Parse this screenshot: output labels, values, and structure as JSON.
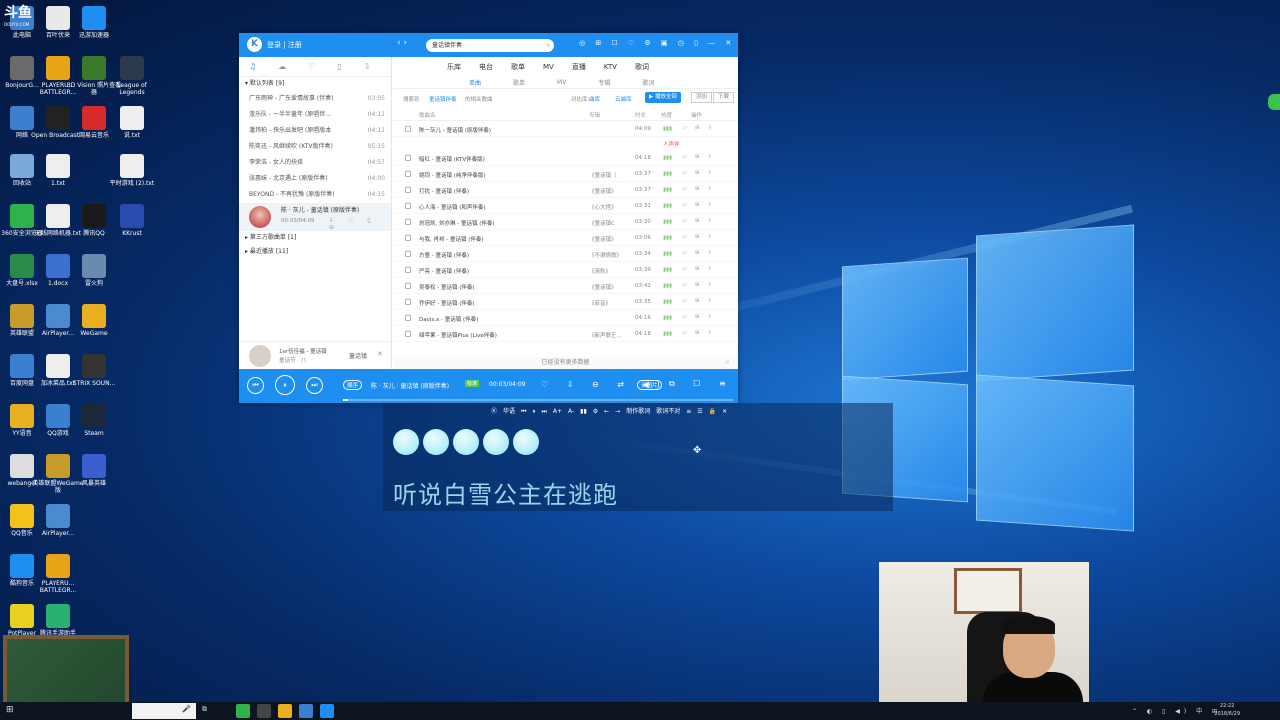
{
  "watermark": {
    "brand": "斗鱼",
    "sub": "DOUYU.COM"
  },
  "desktop_icons": [
    {
      "label": "此电脑",
      "icon": "computer-icon",
      "color": "#3b7fd0"
    },
    {
      "label": "百叶伏来",
      "icon": "file-icon",
      "color": "#e9e9e9"
    },
    {
      "label": "迅游加速器",
      "icon": "kugou-icon",
      "color": "#1f8ef1"
    },
    {
      "label": "BonjourG...",
      "icon": "game-icon",
      "color": "#6a6a6a"
    },
    {
      "label": "PLAYERU... BATTLEGR...",
      "icon": "pubg-icon",
      "color": "#e8a317"
    },
    {
      "label": "3D Vision 照片查看器",
      "icon": "nvidia-icon",
      "color": "#3a7a2a"
    },
    {
      "label": "League of Legends",
      "icon": "lol-icon",
      "color": "#2a3a4a"
    },
    {
      "label": "网络",
      "icon": "network-icon",
      "color": "#3b7fd0"
    },
    {
      "label": "Open Broadcast...",
      "icon": "obs-icon",
      "color": "#222"
    },
    {
      "label": "网易云音乐",
      "icon": "netease-icon",
      "color": "#d62b2b"
    },
    {
      "label": "说.txt",
      "icon": "txt-icon",
      "color": "#eee"
    },
    {
      "label": "回收站",
      "icon": "recycle-bin-icon",
      "color": "#7aa8d8"
    },
    {
      "label": "1.txt",
      "icon": "txt-icon",
      "color": "#eee"
    },
    {
      "label": "平时游戏 (2).txt",
      "icon": "txt-icon",
      "color": "#eee"
    },
    {
      "label": "360安全浏览器",
      "icon": "browser-icon",
      "color": "#2db34a"
    },
    {
      "label": "无线网络机器.txt",
      "icon": "txt-icon",
      "color": "#eee"
    },
    {
      "label": "腾讯QQ",
      "icon": "qq-icon",
      "color": "#1a1a1a"
    },
    {
      "label": "KKrust",
      "icon": "tool-icon",
      "color": "#2b4ab0"
    },
    {
      "label": "大盘号.xlsx",
      "icon": "xlsx-icon",
      "color": "#2a8a4a"
    },
    {
      "label": "1.docx",
      "icon": "docx-icon",
      "color": "#3b6fd0"
    },
    {
      "label": "雷火狗",
      "icon": "game-icon",
      "color": "#6a8ab0"
    },
    {
      "label": "英雄联盟",
      "icon": "game-icon",
      "color": "#c79a2a"
    },
    {
      "label": "AirPlayer...",
      "icon": "airplayer-icon",
      "color": "#4a8ad0"
    },
    {
      "label": "WeGame",
      "icon": "wegame-icon",
      "color": "#e8b020"
    },
    {
      "label": "百度网盘",
      "icon": "baidu-cloud-icon",
      "color": "#3b7fd0"
    },
    {
      "label": "加冰菜品.txt",
      "icon": "txt-icon",
      "color": "#eee"
    },
    {
      "label": "STRIX SOUN...",
      "icon": "strix-icon",
      "color": "#333"
    },
    {
      "label": "YY语音",
      "icon": "yy-icon",
      "color": "#e8b020"
    },
    {
      "label": "QQ游戏",
      "icon": "qq-game-icon",
      "color": "#3b7fd0"
    },
    {
      "label": "Steam",
      "icon": "steam-icon",
      "color": "#1b2838"
    },
    {
      "label": "webangel",
      "icon": "web-icon",
      "color": "#ddd"
    },
    {
      "label": "英雄联盟WeGame版",
      "icon": "game-icon",
      "color": "#c79a2a"
    },
    {
      "label": "风暴英雄",
      "icon": "game-icon",
      "color": "#3b5fd0"
    },
    {
      "label": "QQ音乐",
      "icon": "qq-music-icon",
      "color": "#f2c21a"
    },
    {
      "label": "AirPlayer...",
      "icon": "airplayer-icon",
      "color": "#4a8ad0"
    },
    {
      "label": "酷狗音乐",
      "icon": "kugou-icon",
      "color": "#1f8ef1"
    },
    {
      "label": "PLAYERU... BATTLEGR...",
      "icon": "pubg-icon",
      "color": "#e8a317"
    },
    {
      "label": "PotPlayer",
      "icon": "potplayer-icon",
      "color": "#e8d020"
    },
    {
      "label": "腾讯手游助手",
      "icon": "tencent-icon",
      "color": "#2ab070"
    }
  ],
  "player": {
    "login": "登录 | 注册",
    "search": "童话镇伴奏",
    "window_tools": "◎ ⊞ ☐ ♡ ⚙ ▣ ◷ ▯ — ✕",
    "left_nav_icons": [
      "♫",
      "☁",
      "♡",
      "▯",
      "⇩"
    ],
    "top_nav": [
      "乐库",
      "电台",
      "歌单",
      "MV",
      "直播",
      "KTV",
      "歌词"
    ],
    "sub_nav": [
      "单曲",
      "歌单",
      "MV",
      "专辑",
      "歌词"
    ],
    "default_list": "▾ 默认列表 [9]",
    "left_songs": [
      {
        "title": "广东雨神 - 广东爱情故事 (伴奏)",
        "time": "03:05"
      },
      {
        "title": "渣乐队 - 一半半童年 (原唱伴...",
        "time": "04:11"
      },
      {
        "title": "潘玮柏 - 快乐出发吧 (原唱版本",
        "time": "04:11"
      },
      {
        "title": "陈奕迅 - 风继续吹 (KTV版伴奏)",
        "time": "05:15"
      },
      {
        "title": "李荣浩 - 女人的抉择",
        "time": "04:57"
      },
      {
        "title": "张惠妹 - 北京遇上 (原版伴奏)",
        "time": "04:00"
      },
      {
        "title": "BEYOND - 不再犹豫 (原版伴奏)",
        "time": "04:15"
      }
    ],
    "now_playing": {
      "title": "陈 · 灰儿 - 童话镇 (原版伴奏)",
      "time": "00:03/04:09",
      "icons": "⇩ ♡ ▯ ⊖"
    },
    "group_third": "▸ 第三方歌曲单 [1]",
    "group_recent": "▸ 最近播放 [11]",
    "search_bar": {
      "label": "搜索到",
      "keyword": "童话镇伴奏",
      "related": "的相关歌曲",
      "filter": "对比库:",
      "opt1": "曲库",
      "opt2": "云端库",
      "play_all": "▶ 播放全部",
      "add": "添加",
      "download": "下载"
    },
    "table_head": {
      "name": "歌曲名",
      "album": "专辑",
      "duration": "时长",
      "hot": "热度",
      "ops": "操作"
    },
    "results": [
      {
        "name": "陈一灰儿 - 童话镇 (原版伴奏)",
        "album": "",
        "duration": "04:09"
      },
      {
        "name": "暗杠 - 童话镇 (KTV伴奏版)",
        "album": "",
        "duration": "04:18"
      },
      {
        "name": "姚钧 - 童话镇 (纯净伴奏版)",
        "album": "《童话镇（",
        "duration": "03:37"
      },
      {
        "name": "打扰 - 童话镇 (伴奏)",
        "album": "《童话镇》",
        "duration": "03:37"
      },
      {
        "name": "心人海 - 童话镇 (和声伴奏)",
        "album": "《心大怪》",
        "duration": "03:31"
      },
      {
        "name": "刘冠凯, 刘亦琳 - 童话镇 (伴奏)",
        "album": "《童话镇C",
        "duration": "03:30"
      },
      {
        "name": "与我, 肖邦 - 童话镇 (伴奏)",
        "album": "《童话镇》",
        "duration": "03:06"
      },
      {
        "name": "方童 - 童话镇 (伴奏)",
        "album": "《不谢情歌》",
        "duration": "03:34"
      },
      {
        "name": "严亮 - 童话镇 (伴奏)",
        "album": "《清秋》",
        "duration": "03:39"
      },
      {
        "name": "吴泰权 - 童话镇 (伴奏)",
        "album": "《童话镇》",
        "duration": "03:42"
      },
      {
        "name": "乔伊好 - 童话镇 (伴奏)",
        "album": "《菲音》",
        "duration": "03:35"
      },
      {
        "name": "Davis.x - 童话镇 (伴奏)",
        "album": "",
        "duration": "04:16"
      },
      {
        "name": "绿苹果 - 童话镇Plus (Live伴奏)",
        "album": "《新声歌王...",
        "duration": "04:18"
      }
    ],
    "hot_marks": "▮▮▮",
    "row_ops": "▷ ⊞ ⇩",
    "extra": "人声伴",
    "footer": "已经没有更多数据",
    "footer_close": "✕",
    "sidebar_card": {
      "line1": "1er伍佳福 - 童话镇",
      "line2": "童话节 · 八",
      "button": "童话镇"
    },
    "playbar": {
      "prev": "⏮",
      "play": "⏸",
      "next": "⏭",
      "mode": "顺序",
      "song": "陈 · 灰儿 · 童话镇 (原版伴奏)",
      "quality": "标准",
      "time": "00:03/04:09",
      "controls": "♡ ⇩ ⊖ ⇄ ◀)",
      "lyric_btn": "词图片",
      "right": "⧉ ☐ ≡",
      "progress": 0.012
    }
  },
  "lyric_window": {
    "toolbar": [
      "Ⓚ",
      "华语",
      "⏮",
      "⏸",
      "⏭",
      "A+",
      "A-",
      "▮▮",
      "⚙",
      "←",
      "→",
      "制作歌词",
      "歌词不对",
      "≡",
      "☰",
      "🔒",
      "✕"
    ],
    "line": "听说白雪公主在逃跑",
    "bubble_count": 5,
    "colors": {
      "active": "#9ad6ea"
    }
  },
  "taskbar": {
    "apps": [
      "#2db34a",
      "#444",
      "#e8b020",
      "#3b7fd0",
      "#1f8ef1"
    ],
    "tray": "⌃ ◐ ▯ ◀) 中 ⊞",
    "time": "22:22",
    "date": "2018/6/29"
  }
}
